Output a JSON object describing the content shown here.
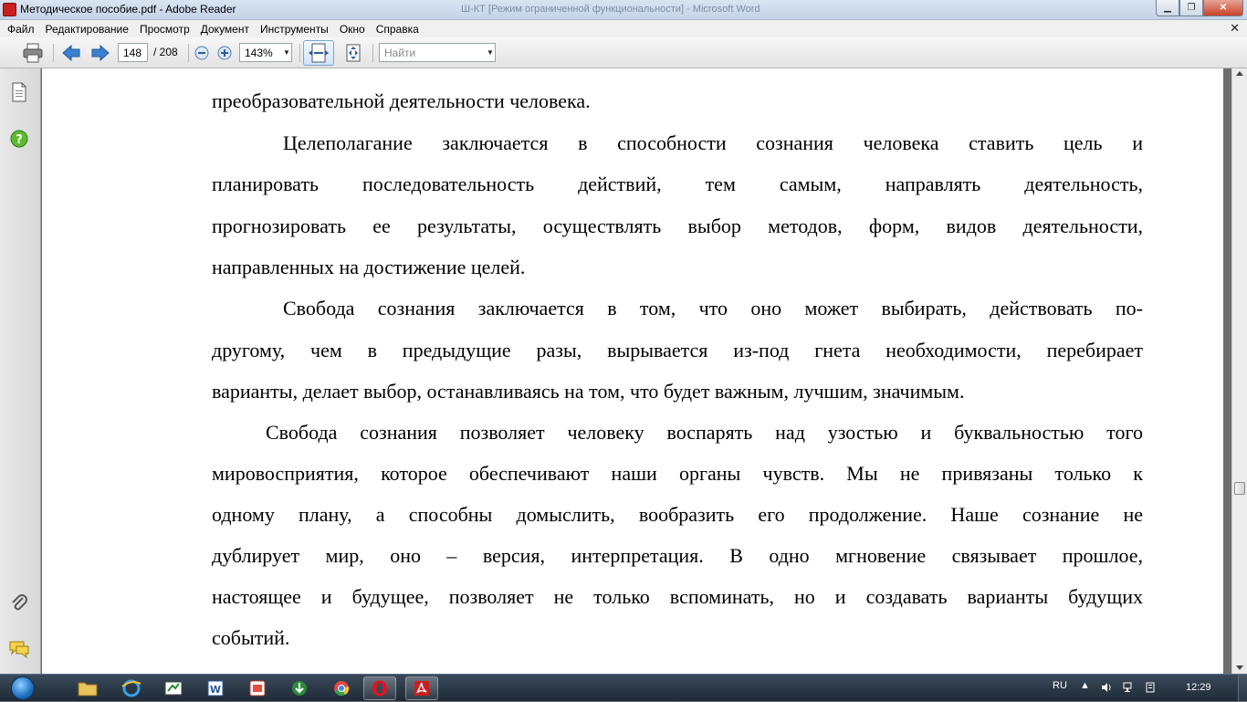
{
  "window": {
    "title": "Методическое пособие.pdf - Adobe Reader",
    "background_title": "Ш-КТ [Режим ограниченной функциональности] - Microsoft Word",
    "minimize": "▁",
    "maximize": "❐",
    "close": "✕"
  },
  "menu": {
    "items": [
      "Файл",
      "Редактирование",
      "Просмотр",
      "Документ",
      "Инструменты",
      "Окно",
      "Справка"
    ],
    "close_doc": "✕"
  },
  "toolbar": {
    "current_page": "148",
    "total_pages": "/  208",
    "zoom": "143%",
    "search_placeholder": "Найти"
  },
  "document": {
    "lines": [
      "преобразовательной деятельности человека.",
      "Целеполагание заключается в способности сознания человека ставить цель и",
      "планировать последовательность действий, тем самым, направлять деятельность,",
      "прогнозировать ее результаты, осуществлять выбор методов, форм, видов деятельности,",
      "направленных на достижение целей.",
      "Свобода сознания заключается в том, что оно может выбирать, действовать по-",
      "другому, чем в предыдущие разы, вырывается из-под гнета необходимости, перебирает",
      "варианты, делает выбор, останавливаясь на том, что будет важным, лучшим, значимым.",
      "Свобода сознания позволяет человеку воспарять над узостью и буквальностью того",
      "мировосприятия, которое обеспечивают наши органы чувств. Мы не привязаны только к",
      "одному плану, а способны домыслить, вообразить его продолжение. Наше сознание не",
      "дублирует мир, оно – версия, интерпретация. В одно мгновение связывает прошлое,",
      "настоящее и будущее, позволяет не только вспоминать, но и создавать варианты будущих",
      "событий."
    ]
  },
  "taskbar": {
    "language": "RU",
    "clock": "12:29"
  },
  "colors": {
    "titlebar": "#c4d3e6",
    "page_bg": "#ffffff",
    "desk_bg": "#6e6e6e",
    "taskbar": "#1e2a36",
    "adobe_red": "#c8201e"
  }
}
